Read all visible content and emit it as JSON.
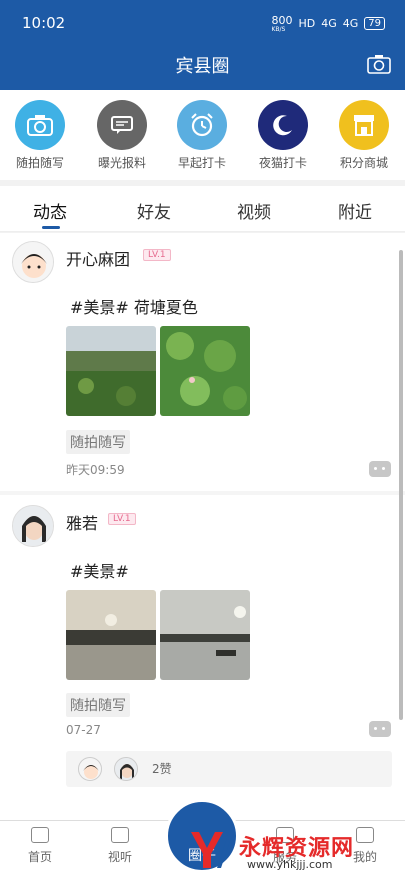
{
  "status_bar": {
    "time": "10:02",
    "speed": "800",
    "speed_unit": "KB/S",
    "hd": "HD",
    "net1": "4G",
    "net2": "4G",
    "battery": "79"
  },
  "header": {
    "title": "宾县圈",
    "camera_icon": "camera-icon",
    "bg_color": "#1d5aa6"
  },
  "shortcuts": [
    {
      "label": "随拍随写",
      "icon": "camera-icon",
      "color": "#3fb1e5"
    },
    {
      "label": "曝光报料",
      "icon": "chat-icon",
      "color": "#666666"
    },
    {
      "label": "早起打卡",
      "icon": "alarm-clock-icon",
      "color": "#5aaee0"
    },
    {
      "label": "夜猫打卡",
      "icon": "moon-icon",
      "color": "#1f2a7a"
    },
    {
      "label": "积分商城",
      "icon": "store-icon",
      "color": "#f0c01e"
    }
  ],
  "tabs": [
    "动态",
    "好友",
    "视频",
    "附近"
  ],
  "posts": [
    {
      "user": "开心麻团",
      "level": "LV.1",
      "text": "#美景# 荷塘夏色",
      "tag": "随拍随写",
      "time": "昨天09:59"
    },
    {
      "user": "雅若",
      "level": "LV.1",
      "text": "#美景#",
      "tag": "随拍随写",
      "time": "07-27",
      "likes": "2赞"
    }
  ],
  "bottom_nav": {
    "home": "首页",
    "video": "视听",
    "center": "圈子",
    "service": "服务",
    "me": "我的"
  },
  "watermark": {
    "main": "永辉资源网",
    "url": "www.yhkjjj.com"
  }
}
